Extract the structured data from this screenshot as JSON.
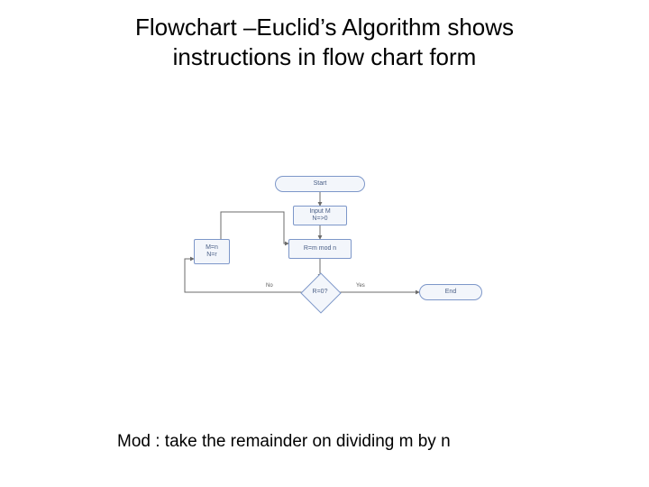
{
  "title_line1": "Flowchart –Euclid’s Algorithm shows",
  "title_line2": "instructions in flow chart form",
  "footnote": "Mod : take the remainder on dividing m by n",
  "nodes": {
    "start": "Start",
    "input": "Input M\nN=>0",
    "compute": "R=m mod n",
    "assign": "M=n\nN=r",
    "decision": "R=0?",
    "end": "End"
  },
  "edges": {
    "yes": "Yes",
    "no": "No"
  }
}
